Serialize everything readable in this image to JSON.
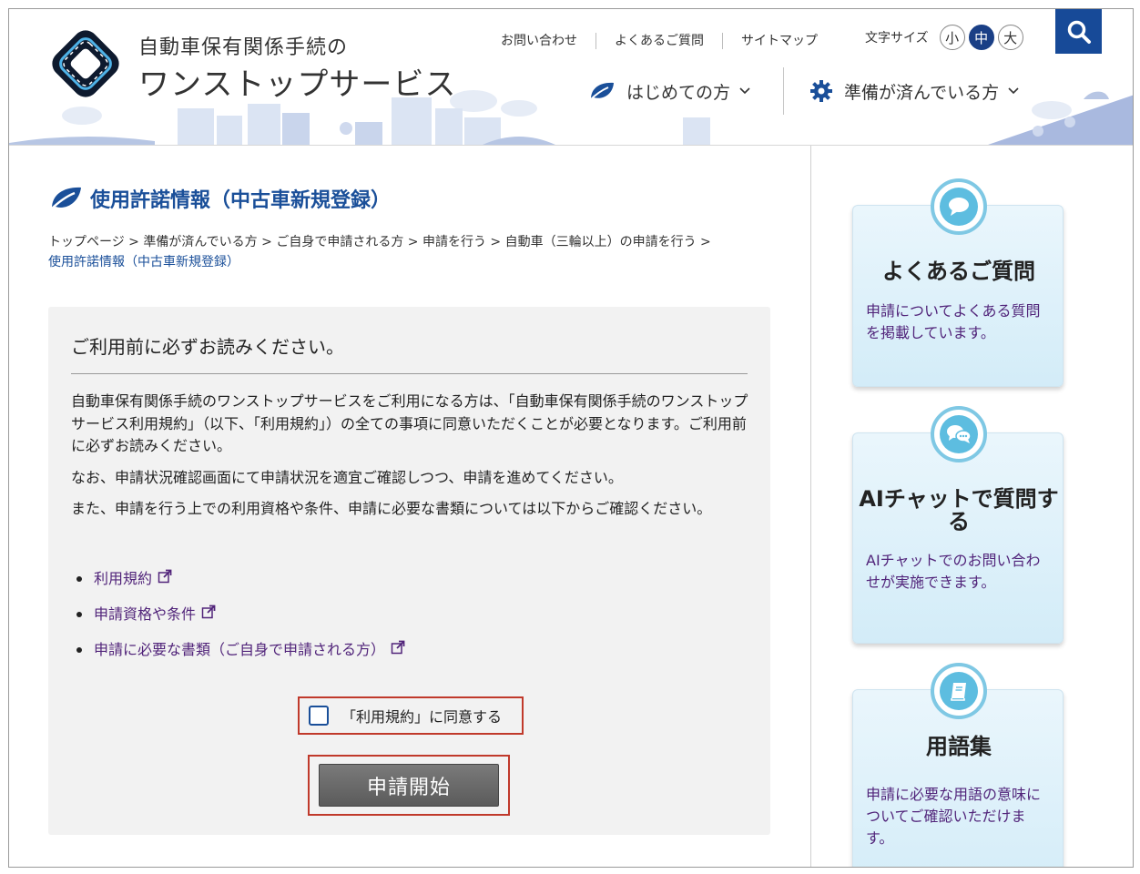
{
  "header": {
    "logo_line1": "自動車保有関係手続の",
    "logo_line2": "ワンストップサービス",
    "util_links": [
      "お問い合わせ",
      "よくあるご質問",
      "サイトマップ"
    ],
    "font_size_label": "文字サイズ",
    "font_sizes": [
      "小",
      "中",
      "大"
    ],
    "font_size_active": "中",
    "main_nav": [
      "はじめての方",
      "準備が済んでいる方"
    ],
    "colors": {
      "brand": "#174a98",
      "title": "#1a4f99"
    }
  },
  "page": {
    "title": "使用許諾情報（中古車新規登録）",
    "breadcrumb": [
      "トップページ",
      "準備が済んでいる方",
      "ご自身で申請される方",
      "申請を行う",
      "自動車（三輪以上）の申請を行う",
      "使用許諾情報（中古車新規登録）"
    ]
  },
  "notice": {
    "heading": "ご利用前に必ずお読みください。",
    "paragraphs": [
      "自動車保有関係手続のワンストップサービスをご利用になる方は、「自動車保有関係手続のワンストップサービス利用規約」（以下、「利用規約」）の全ての事項に同意いただくことが必要となります。ご利用前に必ずお読みください。",
      "なお、申請状況確認画面にて申請状況を適宜ご確認しつつ、申請を進めてください。",
      "また、申請を行う上での利用資格や条件、申請に必要な書類については以下からご確認ください。"
    ],
    "links": [
      "利用規約",
      "申請資格や条件",
      "申請に必要な書類（ご自身で申請される方）"
    ],
    "agree_label": "「利用規約」に同意する",
    "start_button": "申請開始"
  },
  "sidebar": {
    "cards": [
      {
        "title": "よくあるご質問",
        "desc": "申請についてよくある質問を掲載しています。",
        "icon": "speech-bubble-icon"
      },
      {
        "title": "AIチャットで質問する",
        "desc": "AIチャットでのお問い合わせが実施できます。",
        "icon": "chat-bubbles-icon"
      },
      {
        "title": "用語集",
        "desc": "申請に必要な用語の意味についてご確認いただけます。",
        "icon": "book-icon"
      }
    ]
  }
}
